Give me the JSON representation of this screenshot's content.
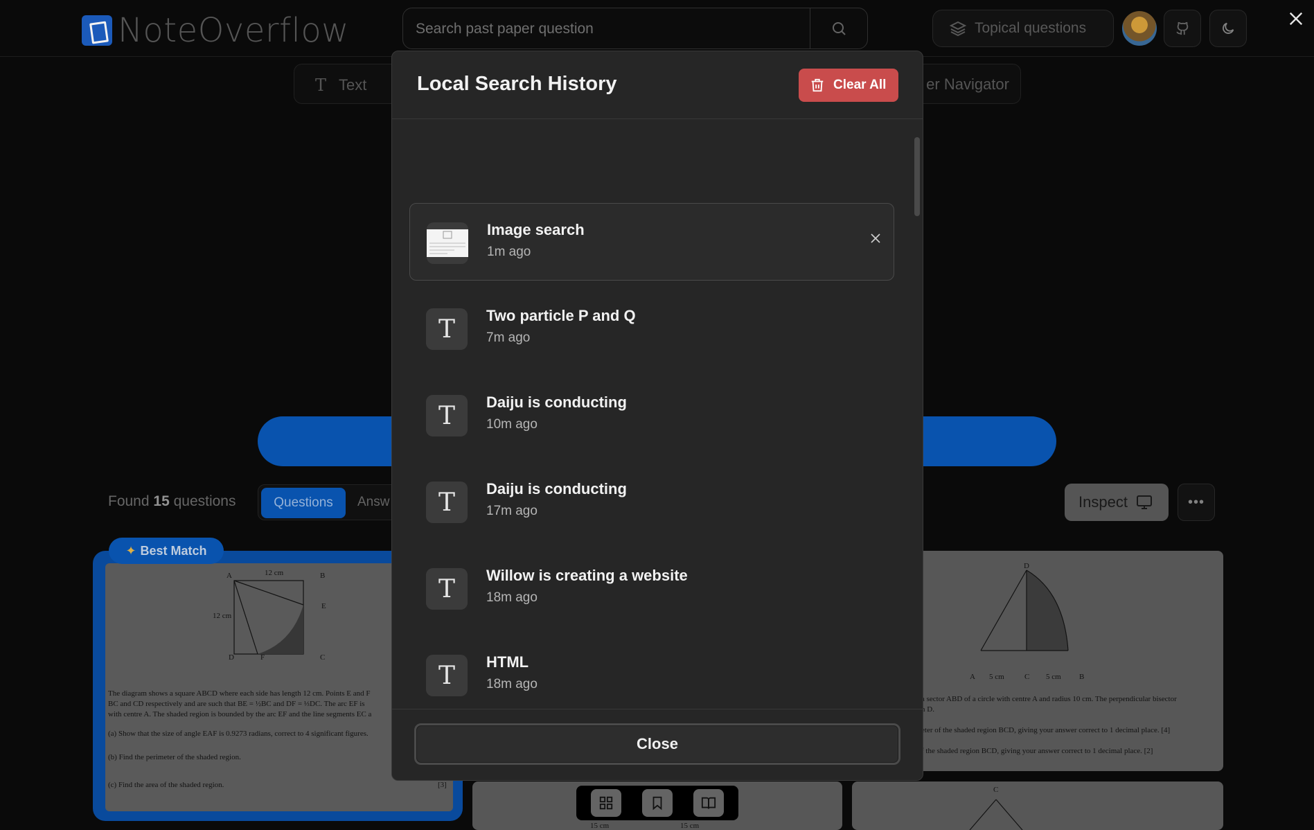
{
  "app": {
    "logo_text": "NoteOverflow",
    "search_placeholder": "Search past paper question",
    "topical_label": "Topical questions",
    "mode_text_label": "Text",
    "mode_nav_label": "er Navigator",
    "found_prefix": "Found",
    "found_count": "15",
    "found_suffix": "questions",
    "tab_questions": "Questions",
    "tab_answers": "Answ",
    "inspect_label": "Inspect",
    "best_match_label": "Best Match"
  },
  "cards": {
    "card1_lines": [
      "The diagram shows a square ABCD where each side has length 12 cm. Points E and F",
      "BC and CD respectively and are such that  BE = ½BC  and  DF = ⅓DC. The arc EF is",
      "with centre A. The shaded region is bounded by the arc EF and the line segments EC a",
      "(a)   Show that the size of angle EAF is 0.9273 radians, correct to 4 significant figures.",
      "(b)   Find the perimeter of the shaded region.",
      "(c)   Find the area of the shaded region."
    ],
    "card1_labels": {
      "a": "A",
      "b": "B",
      "c": "C",
      "d": "D",
      "e": "E",
      "f": "F",
      "top": "12 cm",
      "left": "12 cm",
      "mark": "[3]"
    },
    "card2_lines": [
      "a sector ABD of a circle with centre A and radius 10 cm. The perpendicular bisector",
      "h D.",
      "eter of the shaded region BCD, giving your answer correct to 1 decimal place.    [4]",
      "f the shaded region BCD, giving your answer correct to 1 decimal place.          [2]"
    ],
    "card2_labels": {
      "d": "D",
      "a": "A",
      "c": "C",
      "b": "B",
      "l1": "5 cm",
      "l2": "5 cm"
    },
    "card4_labels": {
      "l1": "15 cm",
      "l2": "15 cm"
    },
    "card3_labels": {
      "c": "C"
    }
  },
  "modal": {
    "title": "Local Search History",
    "clear_all_label": "Clear All",
    "close_label": "Close",
    "items": [
      {
        "title": "Image search",
        "time": "1m ago",
        "kind": "image"
      },
      {
        "title": "Two particle P and Q",
        "time": "7m ago",
        "kind": "text"
      },
      {
        "title": "Daiju is conducting",
        "time": "10m ago",
        "kind": "text"
      },
      {
        "title": "Daiju is conducting",
        "time": "17m ago",
        "kind": "text"
      },
      {
        "title": "Willow is creating a website",
        "time": "18m ago",
        "kind": "text"
      },
      {
        "title": "HTML",
        "time": "18m ago",
        "kind": "text"
      }
    ],
    "text_icon_glyph": "T"
  },
  "colors": {
    "accent": "#0a58b8",
    "danger": "#c94c4c",
    "modal_bg": "#262626",
    "page_bg": "#0b0b0b"
  },
  "icons": [
    "search-icon",
    "layers-icon",
    "github-icon",
    "moon-icon",
    "close-icon",
    "trash-icon",
    "text-type-icon",
    "monitor-icon",
    "more-icon",
    "grid-icon",
    "bookmark-icon",
    "book-open-icon",
    "sparkles-icon"
  ]
}
